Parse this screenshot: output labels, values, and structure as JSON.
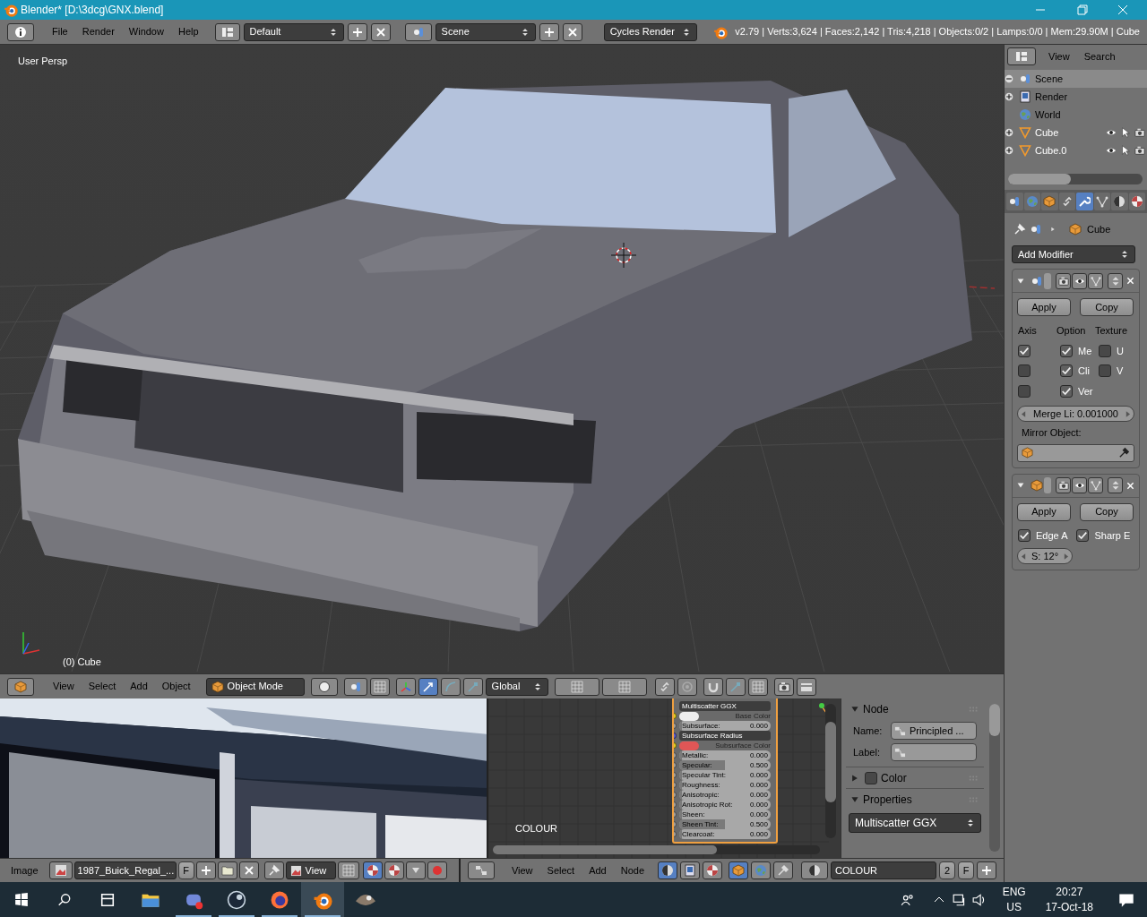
{
  "window": {
    "title": "Blender* [D:\\3dcg\\GNX.blend]"
  },
  "top_bar": {
    "menus": [
      "File",
      "Render",
      "Window",
      "Help"
    ],
    "layout": "Default",
    "scene": "Scene",
    "engine": "Cycles Render",
    "stats": "v2.79 | Verts:3,624 | Faces:2,142 | Tris:4,218 | Objects:0/2 | Lamps:0/0 | Mem:29.90M | Cube"
  },
  "viewport": {
    "view_label": "User Persp",
    "object_label": "(0) Cube"
  },
  "viewport_header": {
    "menus": [
      "View",
      "Select",
      "Add",
      "Object"
    ],
    "mode": "Object Mode",
    "orientation": "Global"
  },
  "outliner": {
    "menus": [
      "View",
      "Search"
    ],
    "items": [
      {
        "kind": "scene",
        "label": "Scene",
        "selected": true,
        "expanded": true,
        "children": [
          {
            "kind": "render",
            "label": "Render",
            "selected": false,
            "expanded": false
          },
          {
            "kind": "world",
            "label": "World",
            "selected": false,
            "expanded": false
          },
          {
            "kind": "object",
            "label": "Cube",
            "selected": false,
            "expanded": false
          },
          {
            "kind": "object",
            "label": "Cube.0",
            "selected": false,
            "expanded": false
          }
        ]
      }
    ]
  },
  "properties": {
    "tabs": [
      {
        "selected": false
      },
      {
        "selected": false
      },
      {
        "selected": false
      },
      {
        "selected": false
      },
      {
        "selected": true
      },
      {
        "selected": false
      },
      {
        "selected": false
      },
      {
        "selected": false
      }
    ],
    "context": "Cube",
    "add_modifier": "Add Modifier",
    "modifiers": [
      {
        "kind": "mirror",
        "expanded": true,
        "apply": "Apply",
        "copy": "Copy",
        "headings": [
          "Axis",
          "Option",
          "Texture"
        ],
        "axis": [
          {
            "checked": true
          },
          {
            "checked": false
          },
          {
            "checked": false
          }
        ],
        "options": [
          {
            "label": "Me",
            "checked": true
          },
          {
            "label": "Cli",
            "checked": true
          },
          {
            "label": "Ver",
            "checked": true
          }
        ],
        "texture": [
          {
            "label": "U",
            "checked": false
          },
          {
            "label": "V",
            "checked": false
          }
        ],
        "merge": "Merge Li: 0.001000",
        "object_label": "Mirror Object:"
      },
      {
        "kind": "edge_split",
        "expanded": true,
        "apply": "Apply",
        "copy": "Copy",
        "options": [
          {
            "label": "Edge A",
            "checked": true
          },
          {
            "label": "Sharp E",
            "checked": true
          }
        ],
        "angle": "S: 12°"
      }
    ]
  },
  "image_editor": {
    "menu": "Image",
    "image": "1987_Buick_Regal_...",
    "fake_user": "F",
    "view": "View"
  },
  "node_editor": {
    "tree_label": "COLOUR",
    "node": {
      "distribution": "Multiscatter GGX",
      "inputs": [
        {
          "kind": "color",
          "label": "Base Color",
          "color": "#eeeeee"
        },
        {
          "kind": "value",
          "label": "Subsurface:",
          "value": "0.000",
          "level": 0
        },
        {
          "kind": "menu",
          "label": "Subsurface Radius"
        },
        {
          "kind": "color",
          "label": "Subsurface Color",
          "color": "#e05656"
        },
        {
          "kind": "value",
          "label": "Metallic:",
          "value": "0.000",
          "level": 0
        },
        {
          "kind": "value",
          "label": "Specular:",
          "value": "0.500",
          "level": 0.5
        },
        {
          "kind": "value",
          "label": "Specular Tint:",
          "value": "0.000",
          "level": 0
        },
        {
          "kind": "value",
          "label": "Roughness:",
          "value": "0.000",
          "level": 0
        },
        {
          "kind": "value",
          "label": "Anisotropic:",
          "value": "0.000",
          "level": 0
        },
        {
          "kind": "value",
          "label": "Anisotropic Rot:",
          "value": "0.000",
          "level": 0
        },
        {
          "kind": "value",
          "label": "Sheen:",
          "value": "0.000",
          "level": 0
        },
        {
          "kind": "value",
          "label": "Sheen Tint:",
          "value": "0.500",
          "level": 0.5
        },
        {
          "kind": "value",
          "label": "Clearcoat:",
          "value": "0.000",
          "level": 0
        }
      ]
    },
    "menus": [
      "View",
      "Select",
      "Add",
      "Node"
    ],
    "material": "COLOUR",
    "users": "2",
    "fake_user": "F"
  },
  "side_panel": {
    "panels": [
      {
        "kind": "node",
        "title": "Node",
        "expanded": true,
        "name_label": "Name:",
        "name": "Principled ...",
        "label_label": "Label:"
      },
      {
        "kind": "color",
        "title": "Color",
        "expanded": false,
        "checked": false
      },
      {
        "kind": "properties",
        "title": "Properties",
        "expanded": true,
        "distribution": "Multiscatter GGX"
      }
    ]
  },
  "taskbar": {
    "apps": [
      {
        "running": false,
        "selected": false
      },
      {
        "running": true,
        "selected": false
      },
      {
        "running": true,
        "selected": false
      },
      {
        "running": true,
        "selected": false
      },
      {
        "running": true,
        "selected": true
      },
      {
        "running": false,
        "selected": false
      }
    ],
    "language": "ENG",
    "region": "US",
    "time": "20:27",
    "date": "17-Oct-18"
  }
}
